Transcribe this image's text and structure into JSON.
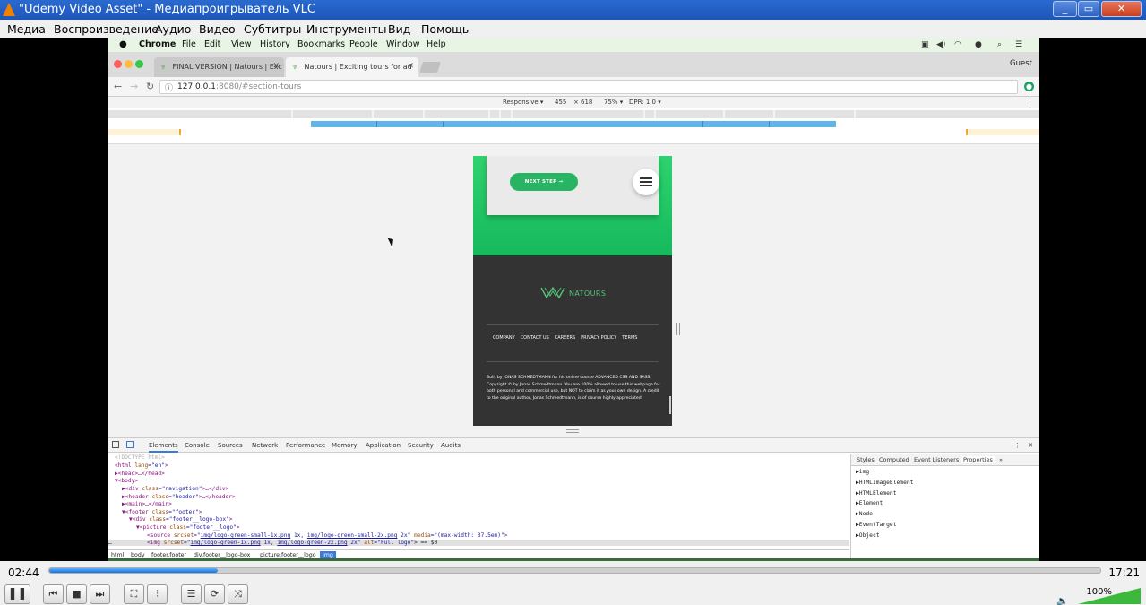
{
  "vlc": {
    "title": "\"Udemy Video Asset\" - Медиапроигрыватель VLC",
    "window_buttons": [
      "_",
      "▭",
      "✕"
    ],
    "menu": [
      "Медиа",
      "Воспроизведение",
      "Аудио",
      "Видео",
      "Субтитры",
      "Инструменты",
      "Вид",
      "Помощь"
    ],
    "time_elapsed": "02:44",
    "time_total": "17:21",
    "progress_fraction": 0.16,
    "volume": "100%",
    "accent": "#3cb83c"
  },
  "mac": {
    "menu": [
      "Chrome",
      "File",
      "Edit",
      "View",
      "History",
      "Bookmarks",
      "People",
      "Window",
      "Help"
    ],
    "status_icons": [
      "cast-icon",
      "volume-icon",
      "wifi-icon",
      "user-icon",
      "search-icon",
      "list-icon"
    ]
  },
  "chrome": {
    "tabs": [
      {
        "label": "FINAL VERSION | Natours | Exc",
        "active": false
      },
      {
        "label": "Natours | Exciting tours for ad",
        "active": true
      }
    ],
    "guest": "Guest",
    "url_host": "127.0.0.1",
    "url_path": ":8080/#section-tours",
    "device": {
      "mode": "Responsive ▾",
      "width": "455",
      "times": "×",
      "height": "618",
      "zoom": "75% ▾",
      "dpr": "DPR: 1.0 ▾"
    }
  },
  "site": {
    "button": "NEXT STEP →",
    "logo_text": "NATOURS",
    "links": [
      "COMPANY",
      "CONTACT US",
      "CAREERS",
      "PRIVACY POLICY",
      "TERMS"
    ],
    "copyright": "Built by JONAS SCHMEDTMANN for his online course ADVANCED CSS AND SASS. Copyright © by Jonas Schmedtmann. You are 100% allowed to use this webpage for both personal and commercial use, but NOT to claim it as your own design. A credit to the original author, Jonas Schmedtmann, is of course highly appreciated!",
    "green": "#28b463"
  },
  "devtools": {
    "tabs": [
      "Elements",
      "Console",
      "Sources",
      "Network",
      "Performance",
      "Memory",
      "Application",
      "Security",
      "Audits"
    ],
    "more": "⋮",
    "close": "✕",
    "lines": {
      "l0": "<!DOCTYPE html>",
      "l1_a": "<html ",
      "l1_b": "lang",
      "l1_c": "=\"en\"",
      "l1_d": ">",
      "l2": "▶<head>…</head>",
      "l3": "▼<body>",
      "l4_a": "▶<div ",
      "l4_b": "class",
      "l4_c": "=\"navigation\"",
      "l4_d": ">…</div>",
      "l5_a": "▶<header ",
      "l5_b": "class",
      "l5_c": "=\"header\"",
      "l5_d": ">…</header>",
      "l6": "▶<main>…</main>",
      "l7_a": "▼<footer ",
      "l7_b": "class",
      "l7_c": "=\"footer\"",
      "l7_d": ">",
      "l8_a": "▼<div ",
      "l8_b": "class",
      "l8_c": "=\"footer__logo-box\"",
      "l8_d": ">",
      "l9_a": "▼<picture ",
      "l9_b": "class",
      "l9_c": "=\"footer__logo\"",
      "l9_d": ">",
      "l10_a": "<source ",
      "l10_b": "srcset",
      "l10_c": "=\"",
      "l10_d": "img/logo-green-small-1x.png",
      "l10_e": " 1x, ",
      "l10_f": "img/logo-green-small-2x.png",
      "l10_g": " 2x\" ",
      "l10_h": "media",
      "l10_i": "=\"(max-width: 37.5em)\"",
      "l10_j": ">",
      "l11_a": "<img ",
      "l11_b": "srcset",
      "l11_c": "=\"",
      "l11_d": "img/logo-green-1x.png",
      "l11_e": " 1x, ",
      "l11_f": "img/logo-green-2x.png",
      "l11_g": " 2x\" ",
      "l11_h": "alt",
      "l11_i": "=\"Full logo\"",
      "l11_j": "> == $0",
      "dots": "…"
    },
    "breadcrumbs": [
      "html",
      "body",
      "footer.footer",
      "div.footer__logo-box",
      "picture.footer__logo",
      "img"
    ],
    "side_tabs": [
      "Styles",
      "Computed",
      "Event Listeners",
      "Properties",
      "»"
    ],
    "properties": [
      "▶img",
      "▶HTMLImageElement",
      "▶HTMLElement",
      "▶Element",
      "▶Node",
      "▶EventTarget",
      "▶Object"
    ]
  }
}
